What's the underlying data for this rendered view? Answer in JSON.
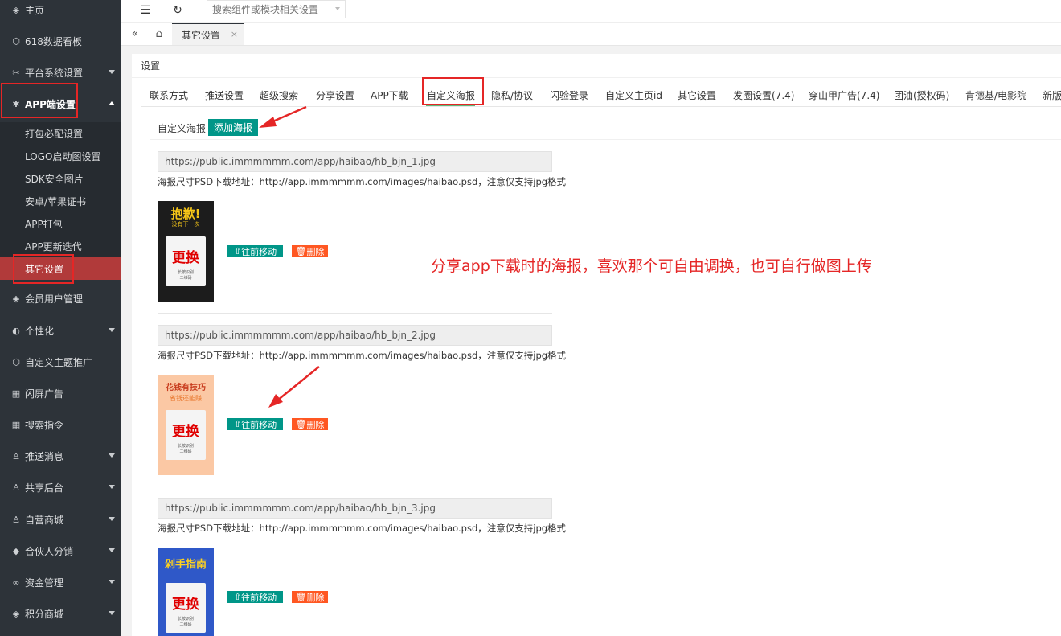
{
  "sidebar": {
    "items": [
      {
        "label": "主页",
        "icon": "shield-icon"
      },
      {
        "label": "618数据看板",
        "icon": "cube-icon"
      },
      {
        "label": "平台系统设置",
        "icon": "tools-icon"
      },
      {
        "label": "APP端设置",
        "icon": "gear-icon"
      },
      {
        "label": "会员用户管理",
        "icon": "shield-icon"
      },
      {
        "label": "个性化",
        "icon": "palette-icon"
      },
      {
        "label": "自定义主题推广",
        "icon": "cube-icon"
      },
      {
        "label": "闪屏广告",
        "icon": "grid-icon"
      },
      {
        "label": "搜索指令",
        "icon": "grid-icon"
      },
      {
        "label": "推送消息",
        "icon": "user-icon"
      },
      {
        "label": "共享后台",
        "icon": "user-icon"
      },
      {
        "label": "自营商城",
        "icon": "user-icon"
      },
      {
        "label": "合伙人分销",
        "icon": "layers-icon"
      },
      {
        "label": "资金管理",
        "icon": "link-icon"
      },
      {
        "label": "积分商城",
        "icon": "shield-icon"
      }
    ],
    "sub_items": [
      "打包必配设置",
      "LOGO启动图设置",
      "SDK安全图片",
      "安卓/苹果证书",
      "APP打包",
      "APP更新迭代",
      "其它设置"
    ]
  },
  "topbar": {
    "search_placeholder": "搜索组件或模块相关设置"
  },
  "tabstrip": {
    "page_tab": "其它设置",
    "close": "×"
  },
  "card": {
    "title": "设置",
    "tabs": [
      "联系方式",
      "推送设置",
      "超级搜索",
      "分享设置",
      "APP下载",
      "自定义海报",
      "隐私/协议",
      "闪验登录",
      "自定义主页id",
      "其它设置",
      "发圈设置(7.4)",
      "穿山甲广告(7.4)",
      "团油(授权码)",
      "肯德基/电影院",
      "新版"
    ],
    "active_tab": "自定义海报"
  },
  "poster_section": {
    "label": "自定义海报",
    "add_button": "添加海报",
    "move_label": "往前移动",
    "delete_label": "删除",
    "change_label": "更换",
    "posters": [
      {
        "url": "https://public.immmmmm.com/app/haibao/hb_bjn_1.jpg",
        "note": "海报尺寸PSD下载地址：http://app.immmmmm.com/images/haibao.psd，注意仅支持jpg格式",
        "headline": "抱歉!",
        "subline": "没有下一次",
        "bg": "#1c1c1c",
        "head_color": "#f5c518",
        "qr_text": "长按识别 二维码"
      },
      {
        "url": "https://public.immmmmm.com/app/haibao/hb_bjn_2.jpg",
        "note": "海报尺寸PSD下载地址：http://app.immmmmm.com/images/haibao.psd，注意仅支持jpg格式",
        "headline": "花钱有技巧",
        "subline": "省钱还能赚",
        "bg": "#fbc8a4",
        "head_color": "#c83c1e",
        "qr_text": "长按识别 二维码"
      },
      {
        "url": "https://public.immmmmm.com/app/haibao/hb_bjn_3.jpg",
        "note": "海报尺寸PSD下载地址：http://app.immmmmm.com/images/haibao.psd，注意仅支持jpg格式",
        "headline": "剁手指南",
        "subline": "",
        "bg": "#2f58c8",
        "head_color": "#ffd21e",
        "qr_text": "长按识别 二维码"
      }
    ]
  },
  "annotation": "分享app下载时的海报，喜欢那个可自由调换，也可自行做图上传",
  "colors": {
    "sidebar_bg": "#2d3339",
    "active_sub": "#b13a3a",
    "primary": "#009688",
    "danger": "#ff5722",
    "annotation_red": "#e52626",
    "tab_underline": "#5fb878"
  }
}
